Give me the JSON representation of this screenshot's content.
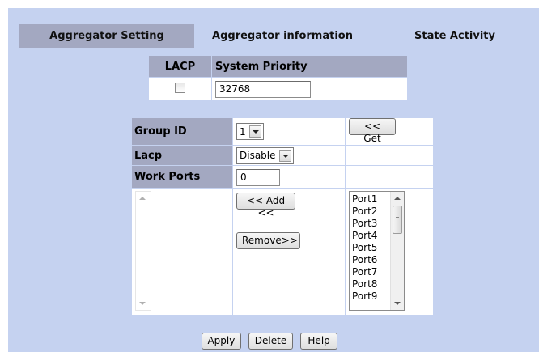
{
  "tabs": [
    {
      "label": "Aggregator Setting"
    },
    {
      "label": "Aggregator information"
    },
    {
      "label": "State Activity"
    }
  ],
  "lacp_table": {
    "col1_header": "LACP",
    "col2_header": "System Priority",
    "system_priority_value": "32768",
    "lacp_checked": false
  },
  "group": {
    "group_id_label": "Group ID",
    "group_id_value": "1",
    "get_button": "<< Get",
    "lacp_label": "Lacp",
    "lacp_value": "Disable",
    "work_ports_label": "Work Ports",
    "work_ports_value": "0",
    "add_button": "<< Add <<",
    "remove_button": "Remove>>",
    "ports": [
      "Port1",
      "Port2",
      "Port3",
      "Port4",
      "Port5",
      "Port6",
      "Port7",
      "Port8",
      "Port9"
    ]
  },
  "actions": {
    "apply": "Apply",
    "delete": "Delete",
    "help": "Help"
  },
  "icons": [
    "scroll-up-icon",
    "scroll-down-icon",
    "dropdown-arrow-icon",
    "scroll-thumb-grip-icon"
  ]
}
